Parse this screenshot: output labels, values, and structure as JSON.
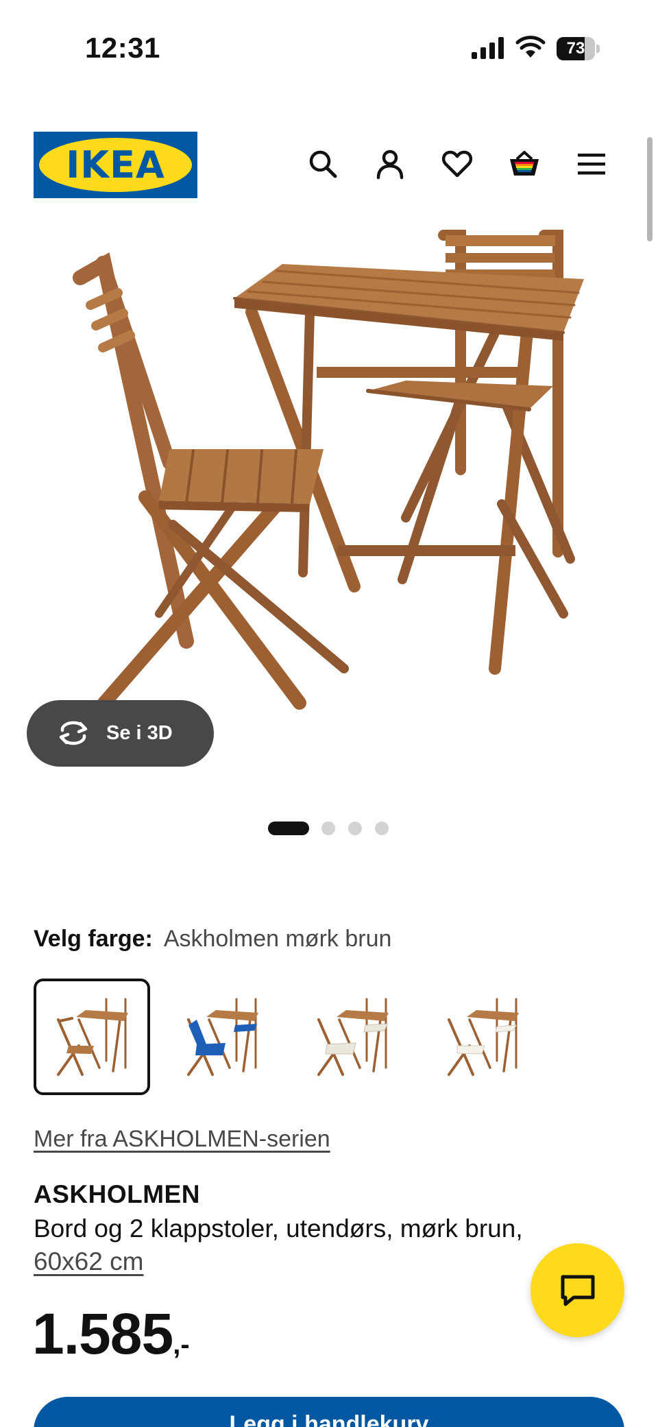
{
  "status_bar": {
    "time": "12:31",
    "battery_level": "73",
    "battery_fraction": 0.73,
    "icons": [
      "signal-icon",
      "wifi-icon",
      "battery-icon"
    ]
  },
  "header": {
    "logo_text": "IKEA",
    "icons": [
      "search-icon",
      "user-icon",
      "heart-icon",
      "shopping-bag-icon",
      "menu-icon"
    ]
  },
  "gallery": {
    "view_3d_label": "Se i 3D",
    "slide_count": 4,
    "active_slide": 1
  },
  "color_picker": {
    "label": "Velg farge:",
    "selected_value": "Askholmen mørk brun",
    "swatches": [
      {
        "cushion": "none",
        "selected": true
      },
      {
        "cushion": "blue",
        "selected": false
      },
      {
        "cushion": "white",
        "selected": false
      },
      {
        "cushion": "white",
        "selected": false
      }
    ]
  },
  "product": {
    "series_link": "Mer fra ASKHOLMEN-serien",
    "name": "ASKHOLMEN",
    "description": "Bord og 2 klappstoler, utendørs, mørk brun,",
    "size": "60x62 cm",
    "price_integer": "1.585",
    "price_suffix": ",-"
  },
  "actions": {
    "add_to_cart_label": "Legg i handlekurv"
  },
  "colors": {
    "ikea_blue": "#0058a3",
    "ikea_yellow": "#ffda1a",
    "wood": "#a8693a",
    "dark_pill": "#484848"
  }
}
